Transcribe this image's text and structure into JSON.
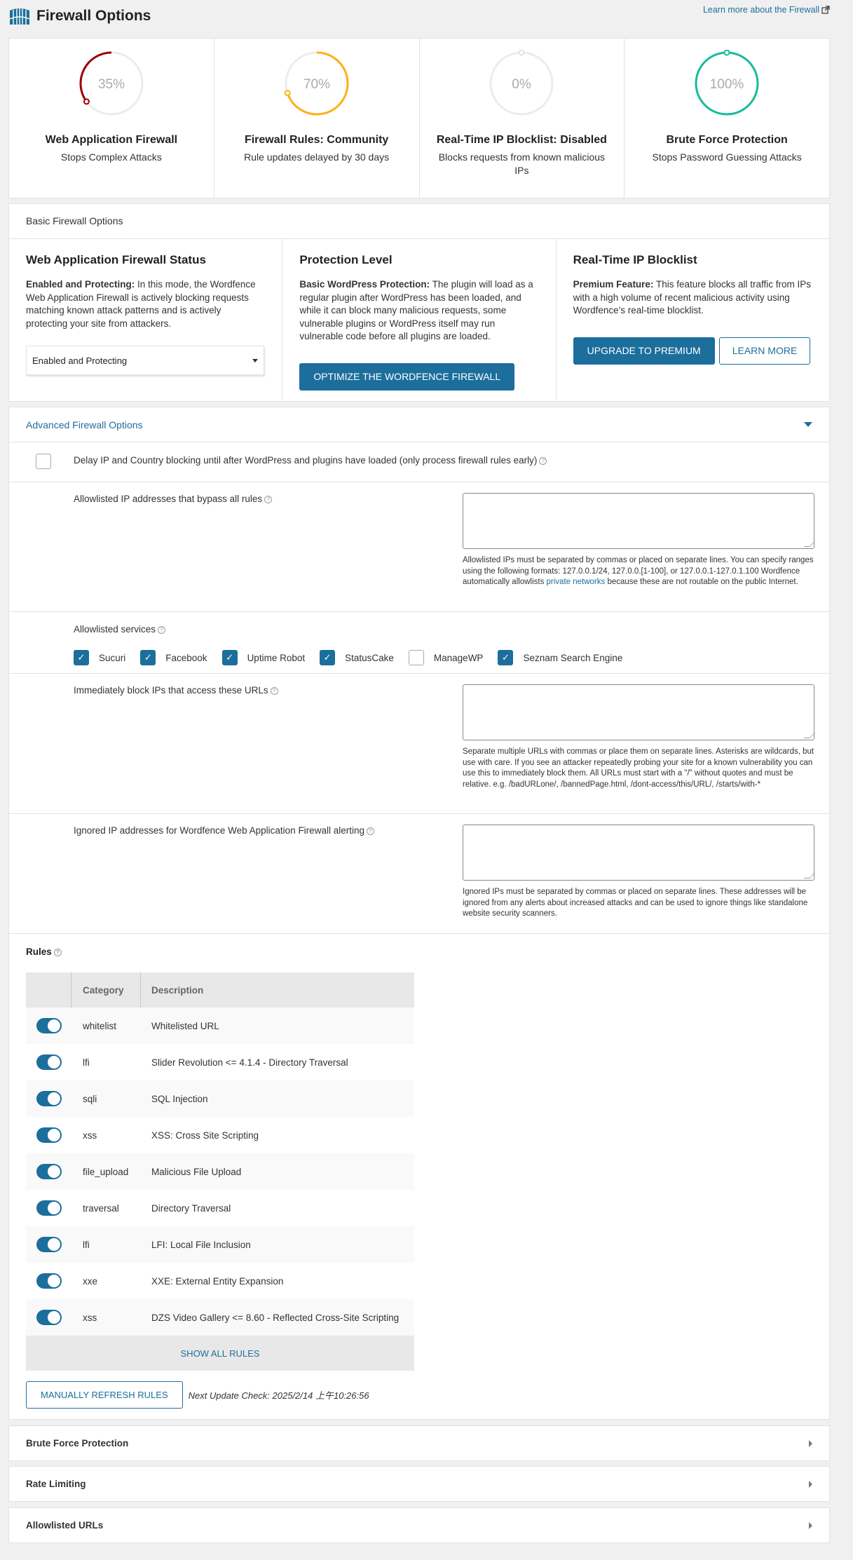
{
  "header": {
    "title": "Firewall Options",
    "learn_more": "Learn more about the Firewall"
  },
  "gauges": [
    {
      "percent": 35,
      "label": "35%",
      "title": "Web Application Firewall",
      "subtitle": "Stops Complex Attacks",
      "color": "#9e0000"
    },
    {
      "percent": 70,
      "label": "70%",
      "title": "Firewall Rules: Community",
      "subtitle": "Rule updates delayed by 30 days",
      "color": "#fcb214"
    },
    {
      "percent": 0,
      "label": "0%",
      "title": "Real-Time IP Blocklist: Disabled",
      "subtitle": "Blocks requests from known malicious IPs",
      "color": "#ececec"
    },
    {
      "percent": 100,
      "label": "100%",
      "title": "Brute Force Protection",
      "subtitle": "Stops Password Guessing Attacks",
      "color": "#16bc9b"
    }
  ],
  "basic": {
    "heading": "Basic Firewall Options",
    "waf_status": {
      "title": "Web Application Firewall Status",
      "bold": "Enabled and Protecting:",
      "text": " In this mode, the Wordfence Web Application Firewall is actively blocking requests matching known attack patterns and is actively protecting your site from attackers.",
      "select_value": "Enabled and Protecting"
    },
    "protection": {
      "title": "Protection Level",
      "bold": "Basic WordPress Protection:",
      "text": " The plugin will load as a regular plugin after WordPress has been loaded, and while it can block many malicious requests, some vulnerable plugins or WordPress itself may run vulnerable code before all plugins are loaded.",
      "button": "Optimize the Wordfence Firewall"
    },
    "blocklist": {
      "title": "Real-Time IP Blocklist",
      "bold": "Premium Feature:",
      "text": " This feature blocks all traffic from IPs with a high volume of recent malicious activity using Wordfence's real-time blocklist.",
      "upgrade_button": "Upgrade to Premium",
      "learn_button": "Learn More"
    }
  },
  "advanced": {
    "heading": "Advanced Firewall Options",
    "delay_option": {
      "label": "Delay IP and Country blocking until after WordPress and plugins have loaded (only process firewall rules early)",
      "checked": false
    },
    "allowlisted_ips": {
      "label": "Allowlisted IP addresses that bypass all rules",
      "value": "",
      "hint_pre": "Allowlisted IPs must be separated by commas or placed on separate lines. You can specify ranges using the following formats: 127.0.0.1/24, 127.0.0.[1-100], or 127.0.0.1-127.0.1.100 Wordfence automatically allowlists ",
      "hint_link": "private networks",
      "hint_post": " because these are not routable on the public Internet."
    },
    "services": {
      "label": "Allowlisted services",
      "items": [
        {
          "name": "Sucuri",
          "checked": true
        },
        {
          "name": "Facebook",
          "checked": true
        },
        {
          "name": "Uptime Robot",
          "checked": true
        },
        {
          "name": "StatusCake",
          "checked": true
        },
        {
          "name": "ManageWP",
          "checked": false
        },
        {
          "name": "Seznam Search Engine",
          "checked": true
        }
      ]
    },
    "block_urls": {
      "label": "Immediately block IPs that access these URLs",
      "value": "",
      "hint": "Separate multiple URLs with commas or place them on separate lines. Asterisks are wildcards, but use with care. If you see an attacker repeatedly probing your site for a known vulnerability you can use this to immediately block them. All URLs must start with a \"/\" without quotes and must be relative. e.g. /badURLone/, /bannedPage.html, /dont-access/this/URL/, /starts/with-*"
    },
    "ignored_ips": {
      "label": "Ignored IP addresses for Wordfence Web Application Firewall alerting",
      "value": "",
      "hint": "Ignored IPs must be separated by commas or placed on separate lines. These addresses will be ignored from any alerts about increased attacks and can be used to ignore things like standalone website security scanners."
    },
    "rules": {
      "title": "Rules",
      "columns": [
        "",
        "Category",
        "Description"
      ],
      "rows": [
        {
          "enabled": true,
          "category": "whitelist",
          "description": "Whitelisted URL"
        },
        {
          "enabled": true,
          "category": "lfi",
          "description": "Slider Revolution <= 4.1.4 - Directory Traversal"
        },
        {
          "enabled": true,
          "category": "sqli",
          "description": "SQL Injection"
        },
        {
          "enabled": true,
          "category": "xss",
          "description": "XSS: Cross Site Scripting"
        },
        {
          "enabled": true,
          "category": "file_upload",
          "description": "Malicious File Upload"
        },
        {
          "enabled": true,
          "category": "traversal",
          "description": "Directory Traversal"
        },
        {
          "enabled": true,
          "category": "lfi",
          "description": "LFI: Local File Inclusion"
        },
        {
          "enabled": true,
          "category": "xxe",
          "description": "XXE: External Entity Expansion"
        },
        {
          "enabled": true,
          "category": "xss",
          "description": "DZS Video Gallery <= 8.60 - Reflected Cross-Site Scripting"
        }
      ],
      "show_all": "Show All Rules",
      "refresh_button": "Manually Refresh Rules",
      "next_update": "Next Update Check: 2025/2/14 上午10:26:56"
    }
  },
  "collapsed_sections": [
    "Brute Force Protection",
    "Rate Limiting",
    "Allowlisted URLs"
  ],
  "colors": {
    "accent": "#1c6e9c"
  }
}
